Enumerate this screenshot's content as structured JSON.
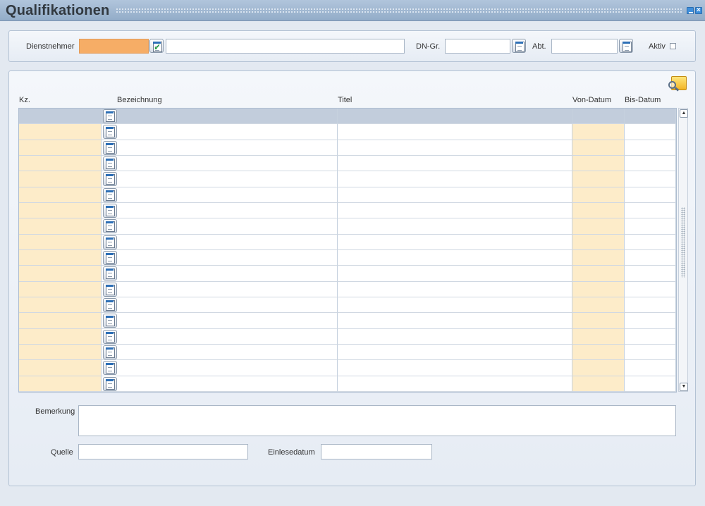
{
  "window": {
    "title": "Qualifikationen"
  },
  "filter": {
    "dienstnehmer_label": "Dienstnehmer",
    "dienstnehmer_code": "",
    "dienstnehmer_name": "",
    "dngr_label": "DN-Gr.",
    "dngr_value": "",
    "abt_label": "Abt.",
    "abt_value": "",
    "aktiv_label": "Aktiv",
    "aktiv_checked": false
  },
  "grid": {
    "columns": [
      "Kz.",
      "Bezeichnung",
      "Titel",
      "Von-Datum",
      "Bis-Datum"
    ],
    "rows": [
      {
        "kz": "",
        "bezeichnung": "",
        "titel": "",
        "von": "",
        "bis": ""
      },
      {
        "kz": "",
        "bezeichnung": "",
        "titel": "",
        "von": "",
        "bis": ""
      },
      {
        "kz": "",
        "bezeichnung": "",
        "titel": "",
        "von": "",
        "bis": ""
      },
      {
        "kz": "",
        "bezeichnung": "",
        "titel": "",
        "von": "",
        "bis": ""
      },
      {
        "kz": "",
        "bezeichnung": "",
        "titel": "",
        "von": "",
        "bis": ""
      },
      {
        "kz": "",
        "bezeichnung": "",
        "titel": "",
        "von": "",
        "bis": ""
      },
      {
        "kz": "",
        "bezeichnung": "",
        "titel": "",
        "von": "",
        "bis": ""
      },
      {
        "kz": "",
        "bezeichnung": "",
        "titel": "",
        "von": "",
        "bis": ""
      },
      {
        "kz": "",
        "bezeichnung": "",
        "titel": "",
        "von": "",
        "bis": ""
      },
      {
        "kz": "",
        "bezeichnung": "",
        "titel": "",
        "von": "",
        "bis": ""
      },
      {
        "kz": "",
        "bezeichnung": "",
        "titel": "",
        "von": "",
        "bis": ""
      },
      {
        "kz": "",
        "bezeichnung": "",
        "titel": "",
        "von": "",
        "bis": ""
      },
      {
        "kz": "",
        "bezeichnung": "",
        "titel": "",
        "von": "",
        "bis": ""
      },
      {
        "kz": "",
        "bezeichnung": "",
        "titel": "",
        "von": "",
        "bis": ""
      },
      {
        "kz": "",
        "bezeichnung": "",
        "titel": "",
        "von": "",
        "bis": ""
      },
      {
        "kz": "",
        "bezeichnung": "",
        "titel": "",
        "von": "",
        "bis": ""
      },
      {
        "kz": "",
        "bezeichnung": "",
        "titel": "",
        "von": "",
        "bis": ""
      },
      {
        "kz": "",
        "bezeichnung": "",
        "titel": "",
        "von": "",
        "bis": ""
      }
    ],
    "selected_row": 0
  },
  "details": {
    "bemerkung_label": "Bemerkung",
    "bemerkung_value": "",
    "quelle_label": "Quelle",
    "quelle_value": "",
    "einlesedatum_label": "Einlesedatum",
    "einlesedatum_value": ""
  },
  "icons": {
    "search": "magnifier-folder-icon",
    "lookup": "document-list-icon",
    "confirm": "checkmark-icon",
    "minimize": "minimize-icon",
    "close": "close-icon"
  },
  "colors": {
    "mandatory_field": "#f6ad66",
    "key_column": "#fdecc9",
    "selected_row": "#c2cddc",
    "titlebar": "#a3b9d3"
  }
}
